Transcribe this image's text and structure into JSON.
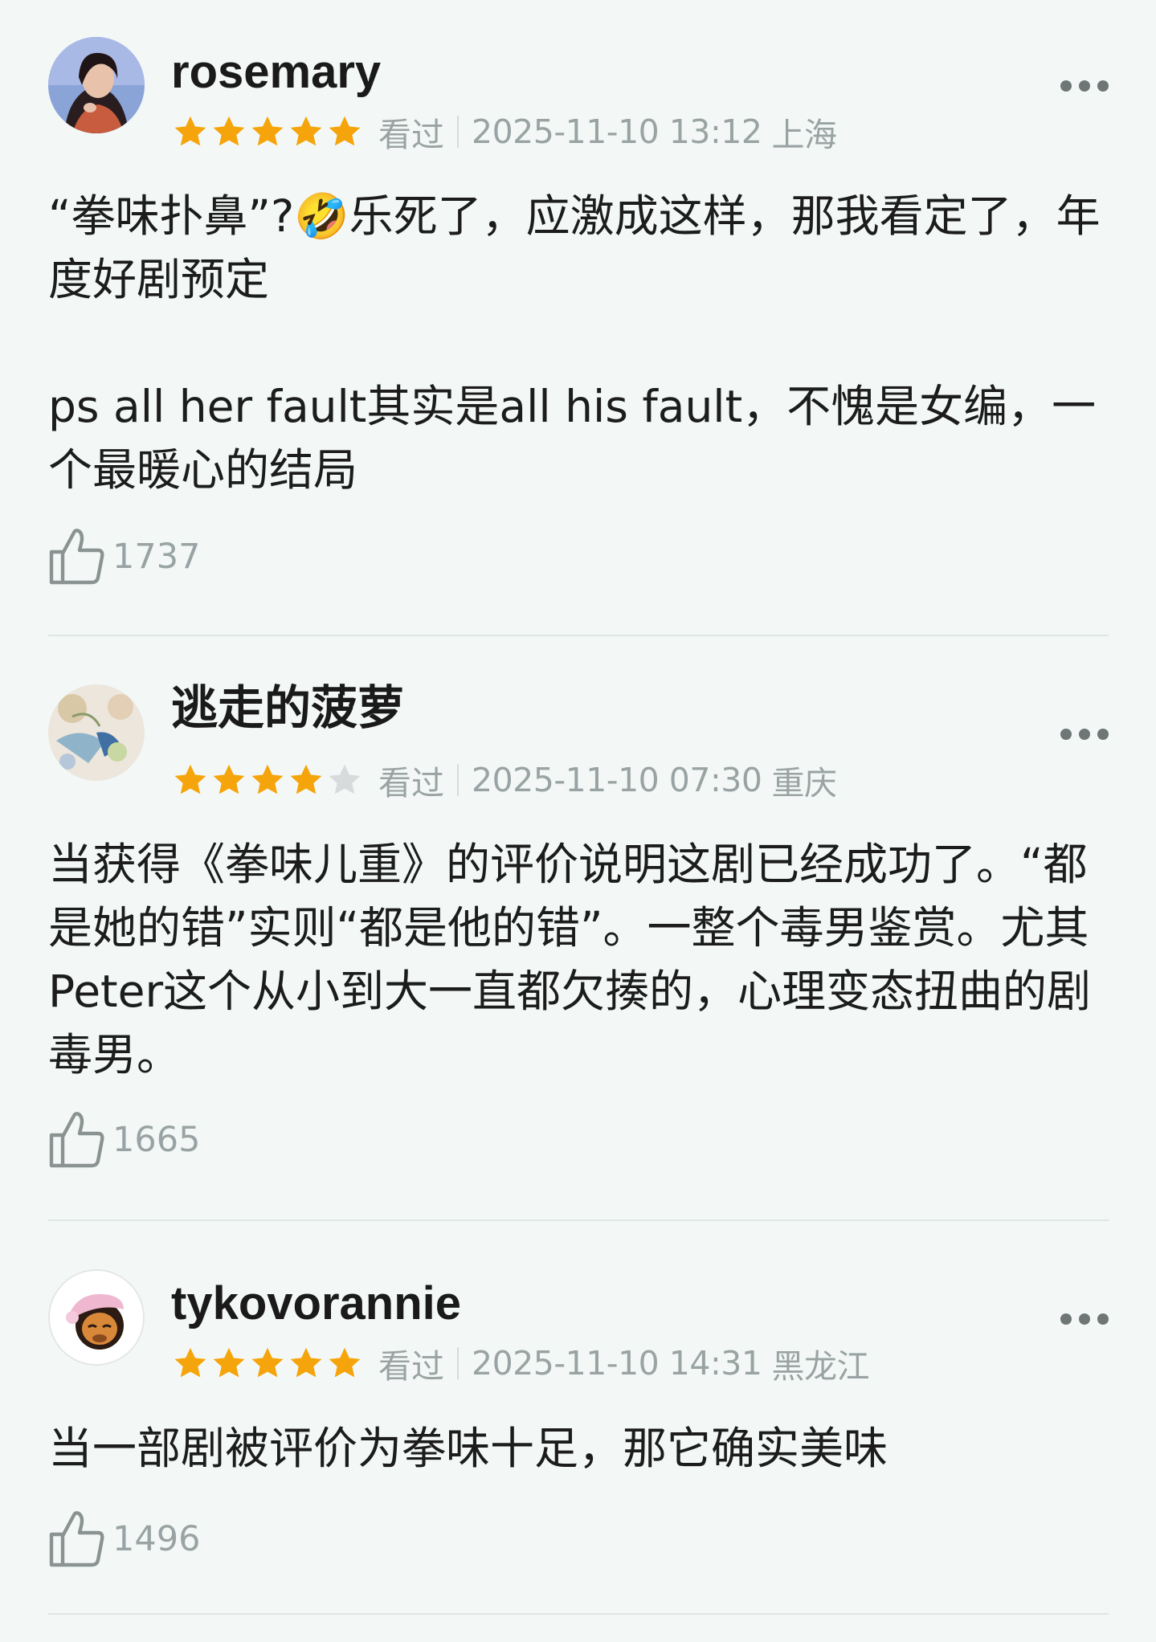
{
  "reviews": [
    {
      "username": "rosemary",
      "rating": 5,
      "watched_label": "看过",
      "time": "2025-11-10 13:12",
      "location": "上海",
      "content": "“拳味扑鼻”?🤣乐死了，应激成这样，那我看定了，年度好剧预定\n\nps all her fault其实是all his fault，不愧是女编，一个最暖心的结局",
      "likes": "1737"
    },
    {
      "username": "逃走的菠萝",
      "rating": 4,
      "watched_label": "看过",
      "time": "2025-11-10 07:30",
      "location": "重庆",
      "content": "当获得《拳味儿重》的评价说明这剧已经成功了。“都是她的错”实则“都是他的错”。一整个毒男鉴赏。尤其Peter这个从小到大一直都欠揍的，心理变态扭曲的剧毒男。",
      "likes": "1665"
    },
    {
      "username": "tykovorannie",
      "rating": 5,
      "watched_label": "看过",
      "time": "2025-11-10 14:31",
      "location": "黑龙江",
      "content": "当一部剧被评价为拳味十足，那它确实美味",
      "likes": "1496"
    }
  ],
  "colors": {
    "star_filled": "#f5a50b",
    "star_empty": "#d7dbdb",
    "meta_text": "#9aa3a3",
    "background": "#f3f8f7"
  },
  "icons": {
    "like": "thumbs-up-icon",
    "more": "more-dots-icon",
    "star": "star-icon"
  }
}
